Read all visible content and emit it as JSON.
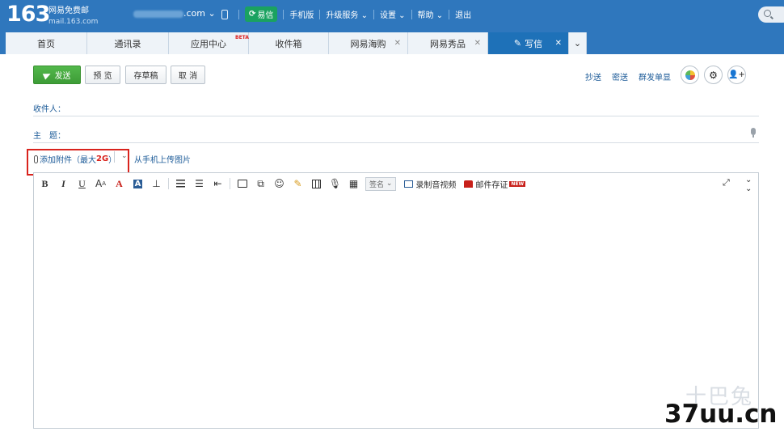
{
  "header": {
    "logo_number": "163",
    "logo_text": "网易免费邮",
    "logo_domain": "mail.163.com",
    "account_suffix": ".com",
    "links": {
      "yixin": "易信",
      "mobile": "手机版",
      "upgrade": "升级服务",
      "settings": "设置",
      "help": "帮助",
      "logout": "退出"
    }
  },
  "tabs": [
    {
      "label": "首页"
    },
    {
      "label": "通讯录"
    },
    {
      "label": "应用中心",
      "badge": "BETA"
    },
    {
      "label": "收件箱"
    },
    {
      "label": "网易海购"
    },
    {
      "label": "网易秀品"
    },
    {
      "label": "写信"
    }
  ],
  "toolbar": {
    "send": "发送",
    "preview": "预 览",
    "draft": "存草稿",
    "cancel": "取 消",
    "cc": "抄送",
    "bcc": "密送",
    "separate": "群发单显"
  },
  "form": {
    "to_label": "收件人：",
    "subject_label": "主　题：",
    "attach_label": "添加附件（最大",
    "attach_size": "2G",
    "attach_close": "）",
    "from_phone": "从手机上传图片"
  },
  "editor": {
    "bold": "B",
    "italic": "I",
    "underline": "U",
    "font_size": "A",
    "font_color": "A",
    "bg_color": "A",
    "signature": "签名",
    "record_video": "录制音视频",
    "mail_evidence": "邮件存证",
    "new_badge": "NEW"
  },
  "watermark": {
    "cn": "十巴兔",
    "text": "37uu.cn"
  }
}
